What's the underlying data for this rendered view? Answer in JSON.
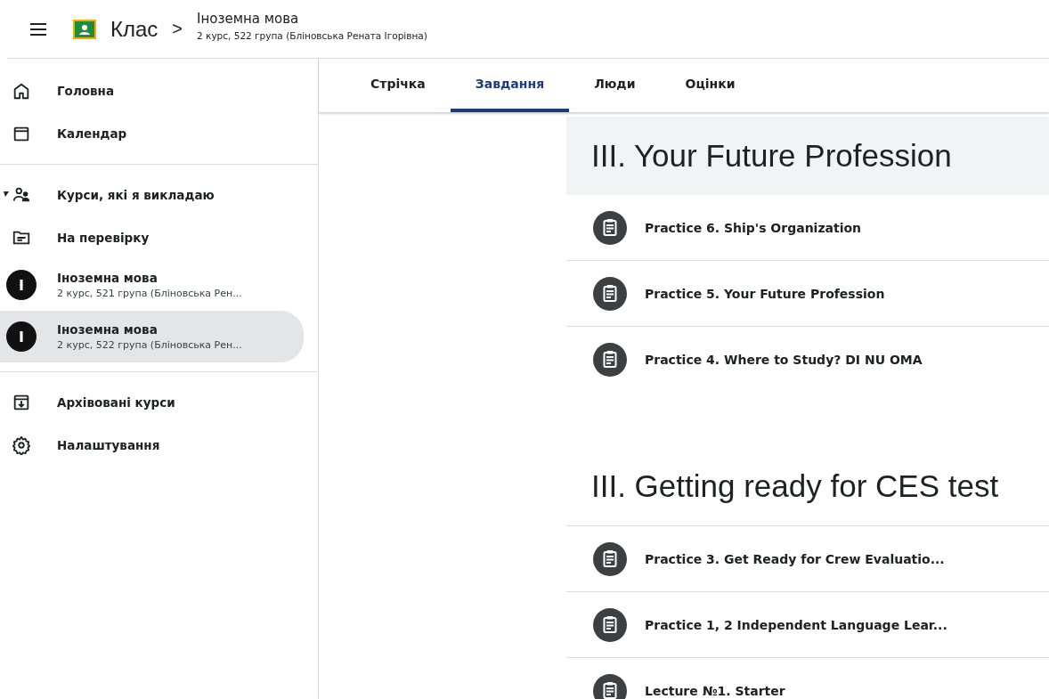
{
  "header": {
    "app_name": "Клас",
    "separator": ">",
    "title": "Іноземна мова",
    "subtitle": "2 курс, 522 група (Бліновська Рената Ігорівна)"
  },
  "sidebar": {
    "groups": [
      {
        "items": [
          {
            "kind": "nav",
            "label": "Головна",
            "selected": false
          },
          {
            "kind": "nav",
            "label": "Календар",
            "selected": false
          }
        ]
      },
      {
        "items": [
          {
            "kind": "nav",
            "label": "Курси, які я викладаю",
            "selected": false
          },
          {
            "kind": "nav",
            "label": "На перевірку",
            "selected": false
          },
          {
            "kind": "course",
            "avatar": "I",
            "label": "Іноземна мова",
            "sublabel": "2 курс, 521 група (Бліновська Рен...",
            "selected": false
          },
          {
            "kind": "course",
            "avatar": "I",
            "label": "Іноземна мова",
            "sublabel": "2 курс, 522 група (Бліновська Рен...",
            "selected": true
          }
        ]
      },
      {
        "items": [
          {
            "kind": "nav",
            "label": "Архівовані курси",
            "selected": false
          },
          {
            "kind": "nav",
            "label": "Налаштування",
            "selected": false
          }
        ]
      }
    ]
  },
  "tabs": [
    {
      "label": "Стрічка",
      "selected": false
    },
    {
      "label": "Завдання",
      "selected": true
    },
    {
      "label": "Люди",
      "selected": false
    },
    {
      "label": "Оцінки",
      "selected": false
    }
  ],
  "topics": [
    {
      "title": "III. Your Future Profession",
      "selected": true,
      "items": [
        {
          "title": "Practice 6. Ship's Organization"
        },
        {
          "title": "Practice 5. Your Future Profession"
        },
        {
          "title": "Practice 4. Where to Study? DI NU OMA"
        }
      ]
    },
    {
      "title": "III. Getting ready for CES test",
      "selected": false,
      "items": [
        {
          "title": "Practice 3. Get Ready for Crew Evaluatio..."
        },
        {
          "title": "Practice 1, 2 Independent Language Lear..."
        },
        {
          "title": "Lecture №1. Starter"
        }
      ]
    }
  ]
}
